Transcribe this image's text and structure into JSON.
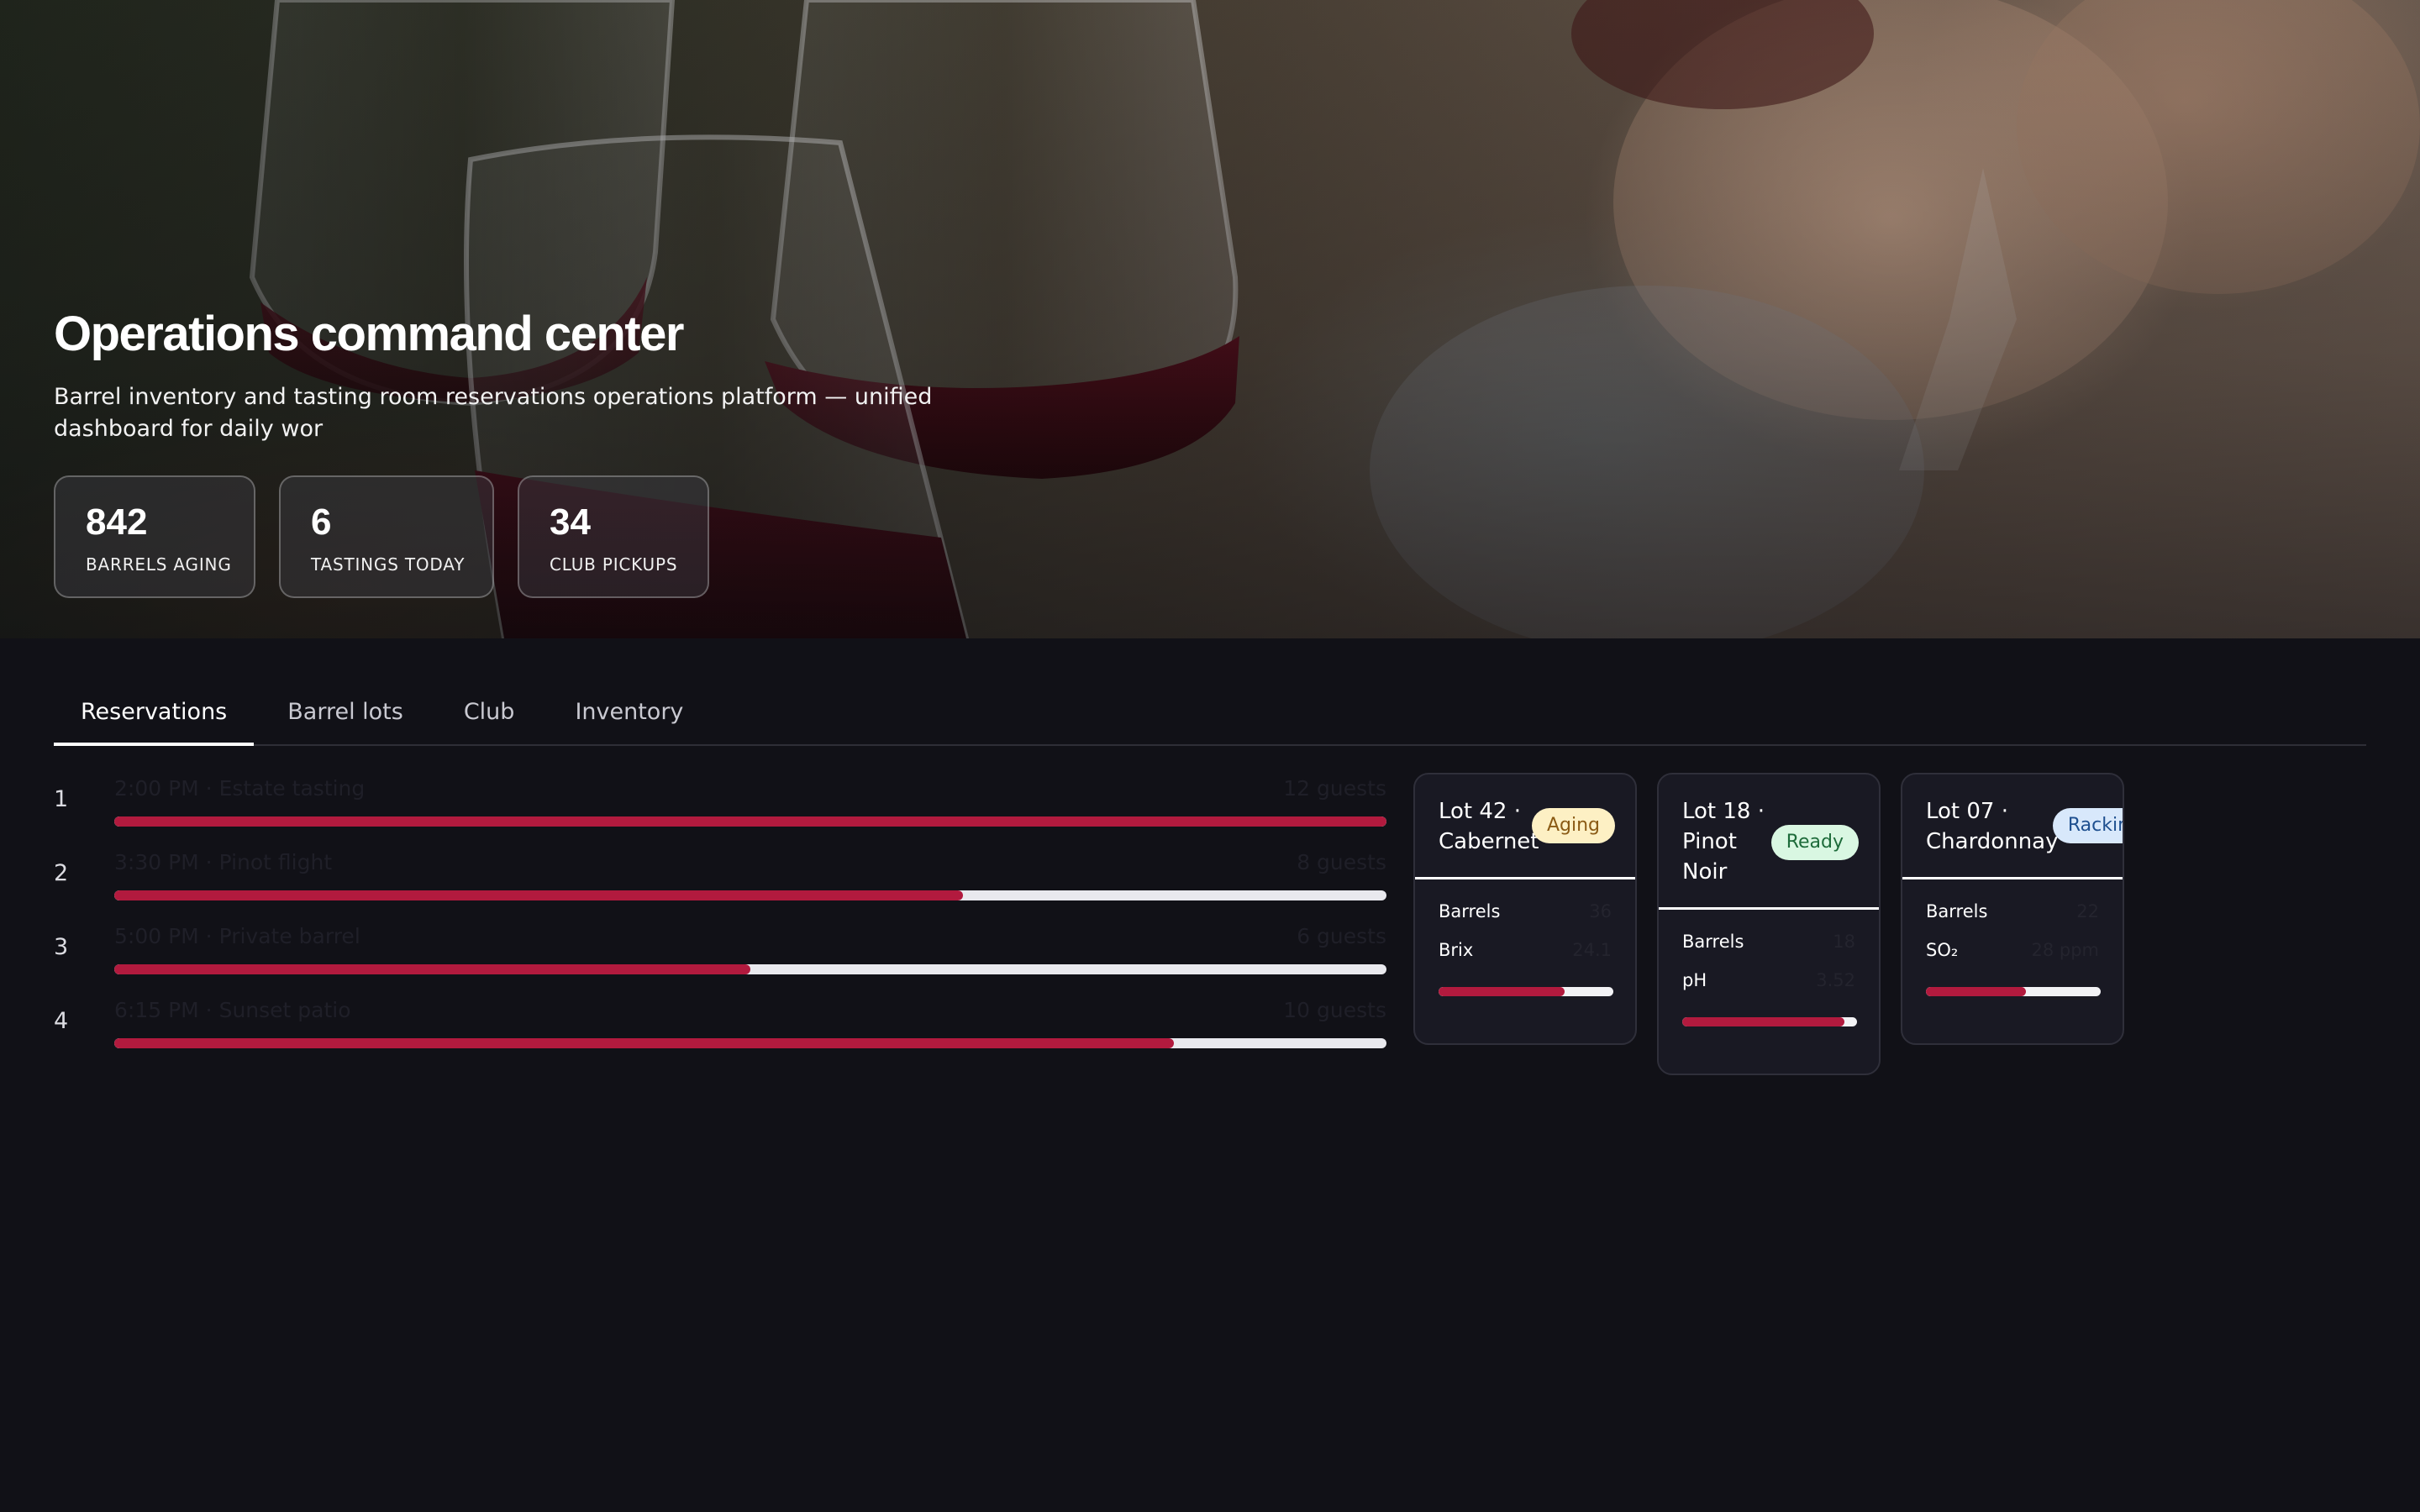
{
  "hero": {
    "title": "Operations command center",
    "subtitle": "Barrel inventory and tasting room reservations operations platform — unified dashboard for daily wor",
    "stats": [
      {
        "value": "842",
        "label": "Barrels aging"
      },
      {
        "value": "6",
        "label": "Tastings today"
      },
      {
        "value": "34",
        "label": "Club pickups"
      }
    ]
  },
  "tabs": [
    {
      "label": "Reservations",
      "active": true
    },
    {
      "label": "Barrel lots",
      "active": false
    },
    {
      "label": "Club",
      "active": false
    },
    {
      "label": "Inventory",
      "active": false
    }
  ],
  "reservations": [
    {
      "num": "1",
      "title": "2:00 PM · Estate tasting",
      "guests": "12 guests",
      "progress": 1.0
    },
    {
      "num": "2",
      "title": "3:30 PM · Pinot flight",
      "guests": "8 guests",
      "progress": 0.667
    },
    {
      "num": "3",
      "title": "5:00 PM · Private barrel",
      "guests": "6 guests",
      "progress": 0.5
    },
    {
      "num": "4",
      "title": "6:15 PM · Sunset patio",
      "guests": "10 guests",
      "progress": 0.833
    }
  ],
  "lots": [
    {
      "name": "Lot 42 · Cabernet",
      "status": "Aging",
      "metric1_label": "Barrels",
      "metric1_value": "36",
      "metric2_label": "Brix",
      "metric2_value": "24.1",
      "progress": 0.72
    },
    {
      "name": "Lot 18 · Pinot Noir",
      "status": "Ready",
      "metric1_label": "Barrels",
      "metric1_value": "18",
      "metric2_label": "pH",
      "metric2_value": "3.52",
      "progress": 0.93
    },
    {
      "name": "Lot 07 · Chardonnay",
      "status": "Racking",
      "metric1_label": "Barrels",
      "metric1_value": "22",
      "metric2_label": "SO₂",
      "metric2_value": "28 ppm",
      "progress": 0.57
    }
  ],
  "colors": {
    "accent": "#b21a3e",
    "background": "#111117",
    "card": "#191923"
  }
}
